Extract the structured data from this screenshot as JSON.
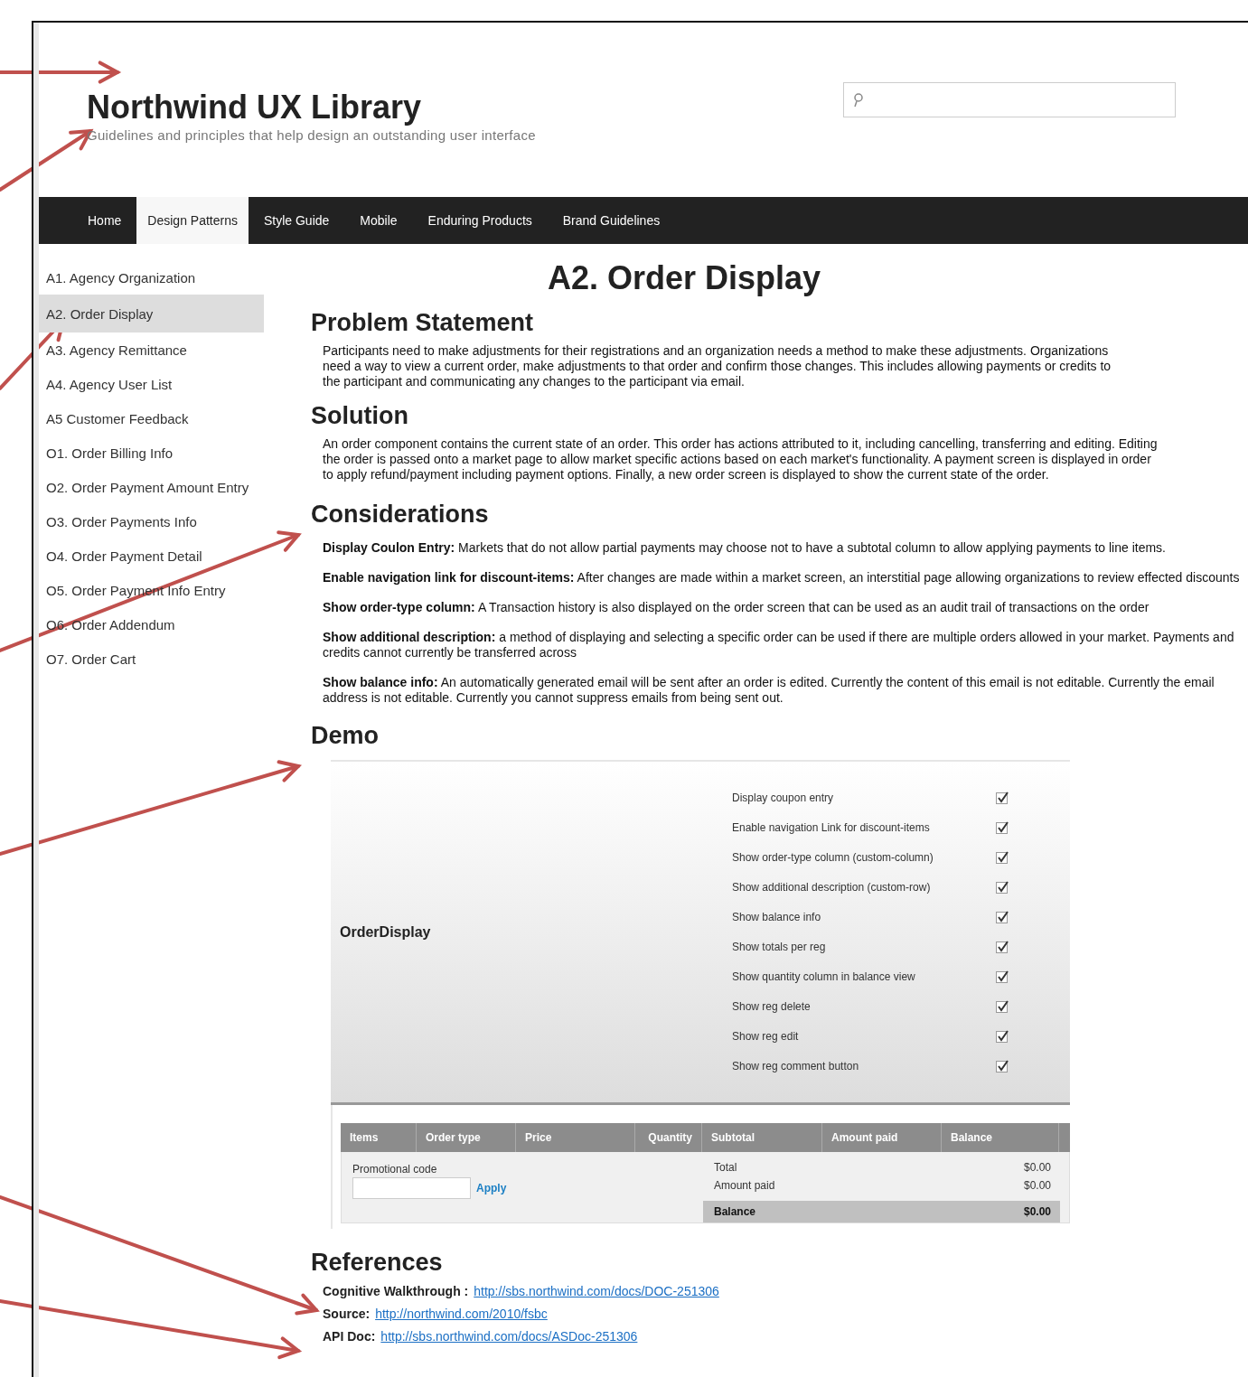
{
  "header": {
    "title": "Northwind UX Library",
    "subtitle": "Guidelines and principles that help design an outstanding user interface"
  },
  "nav": [
    {
      "label": "Home",
      "selected": false
    },
    {
      "label": "Design Patterns",
      "selected": true
    },
    {
      "label": "Style Guide",
      "selected": false
    },
    {
      "label": "Mobile",
      "selected": false
    },
    {
      "label": "Enduring Products",
      "selected": false
    },
    {
      "label": "Brand Guidelines",
      "selected": false
    }
  ],
  "sidebar": {
    "items": [
      {
        "label": "A1. Agency Organization",
        "selected": false
      },
      {
        "label": "A2. Order Display",
        "selected": true
      },
      {
        "label": "A3. Agency Remittance",
        "selected": false
      },
      {
        "label": "A4. Agency User List",
        "selected": false
      },
      {
        "label": "A5 Customer Feedback",
        "selected": false
      },
      {
        "label": "O1. Order Billing Info",
        "selected": false
      },
      {
        "label": "O2. Order Payment Amount Entry",
        "selected": false
      },
      {
        "label": "O3. Order Payments Info",
        "selected": false
      },
      {
        "label": "O4. Order Payment Detail",
        "selected": false
      },
      {
        "label": "O5. Order Payment Info Entry",
        "selected": false
      },
      {
        "label": "O6. Order Addendum",
        "selected": false
      },
      {
        "label": "O7. Order Cart",
        "selected": false
      }
    ]
  },
  "page_title": "A2. Order Display",
  "sections": [
    {
      "heading": "Problem Statement",
      "text": "Participants need to make adjustments for their registrations and an organization needs a method to make these adjustments. Organizations need a way to view a current order, make adjustments to that order and confirm those changes. This includes allowing payments or credits to the participant and communicating any changes to the participant via email."
    },
    {
      "heading": "Solution",
      "text": "An order component contains the current state of an order. This order has actions attributed to it, including cancelling, transferring and editing. Editing the order is passed onto a market page to allow market specific actions based on each market's functionality. A payment screen is displayed in order to apply refund/payment including payment options. Finally, a new order screen is displayed to show the current state of the order."
    }
  ],
  "considerations": {
    "heading": "Considerations",
    "items": [
      "**Display Coulon Entry:** Markets that do not allow partial payments may choose not to have a subtotal column to allow applying payments to line items.",
      "**Enable navigation link for discount-items:** After changes are made within a market screen, an interstitial page allowing organizations to review effected discounts",
      "**Show order-type column:** A Transaction history is also displayed on the order screen that can be used as an audit trail of transactions on the order",
      "**Show additional description:** a method of displaying and selecting a specific order can be used if there are multiple orders allowed in your market. Payments and credits cannot currently be transferred across",
      "**Show balance info:** An automatically generated email will be sent after an order is edited. Currently the content of this email is not editable. Currently the email address is not editable. Currently you cannot suppress emails from being sent out."
    ]
  },
  "demo": {
    "heading": "Demo",
    "component_name": "OrderDisplay",
    "options": [
      {
        "label": "Display coupon entry",
        "checked": true
      },
      {
        "label": "Enable navigation Link for discount-items",
        "checked": true
      },
      {
        "label": "Show order-type column (custom-column)",
        "checked": true
      },
      {
        "label": "Show additional description (custom-row)",
        "checked": true
      },
      {
        "label": "Show balance info",
        "checked": true
      },
      {
        "label": "Show totals per reg",
        "checked": true
      },
      {
        "label": "Show quantity column in balance view",
        "checked": true
      },
      {
        "label": "Show reg delete",
        "checked": true
      },
      {
        "label": "Show reg edit",
        "checked": true
      },
      {
        "label": "Show reg comment button",
        "checked": true
      }
    ],
    "table": {
      "columns": [
        "Items",
        "Order type",
        "Price",
        "Quantity",
        "Subtotal",
        "Amount paid",
        "Balance"
      ],
      "promo_label": "Promotional code",
      "apply": "Apply",
      "totals": [
        {
          "label": "Total",
          "value": "$0.00"
        },
        {
          "label": "Amount paid",
          "value": "$0.00"
        }
      ],
      "balance": {
        "label": "Balance",
        "value": "$0.00"
      }
    }
  },
  "references": {
    "heading": "References",
    "items": [
      {
        "label": "Cognitive Walkthrough :",
        "url": "http://sbs.northwind.com/docs/DOC-251306"
      },
      {
        "label": "Source:",
        "url": "http://northwind.com/2010/fsbc"
      },
      {
        "label": "API Doc:",
        "url": "http://sbs.northwind.com/docs/ASDoc-251306"
      }
    ]
  }
}
